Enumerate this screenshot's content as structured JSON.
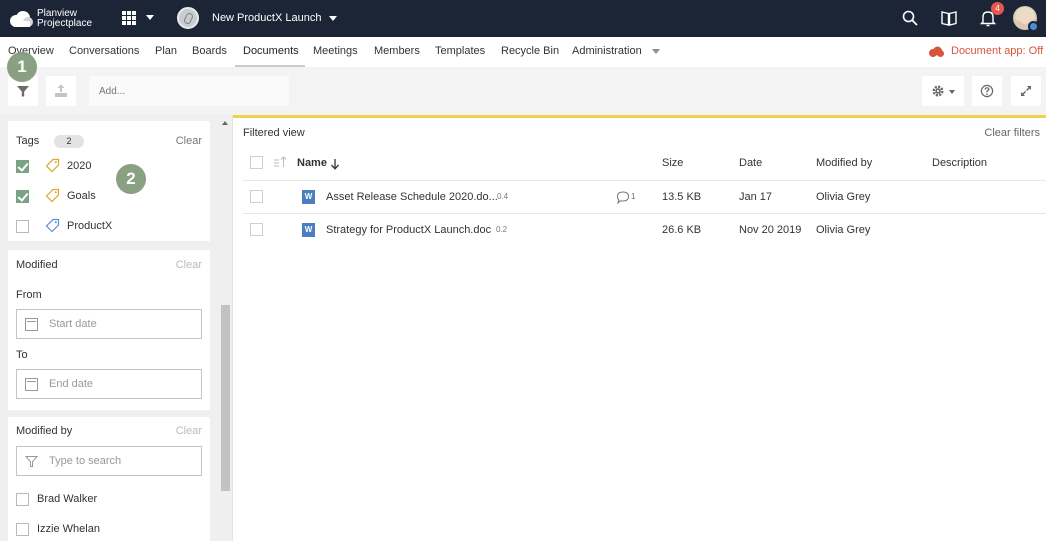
{
  "topbar": {
    "brand_line1": "Planview",
    "brand_line2": "Projectplace",
    "project_name": "New ProductX Launch",
    "notification_count": "4",
    "icons": [
      "cloud-logo-icon",
      "apps-grid-icon",
      "search-icon",
      "book-icon",
      "bell-icon",
      "avatar"
    ]
  },
  "nav": {
    "tabs": [
      "Overview",
      "Conversations",
      "Plan",
      "Boards",
      "Documents",
      "Meetings",
      "Members",
      "Templates",
      "Recycle Bin",
      "Administration"
    ],
    "active_tab": "Documents",
    "doc_app_status": "Document app: Off",
    "accent_color": "#d8553d"
  },
  "toolbar": {
    "add_placeholder": "Add...",
    "icons": [
      "filter-icon",
      "upload-icon",
      "gear-icon",
      "help-icon",
      "expand-icon"
    ]
  },
  "callouts": {
    "step1": "1",
    "step2": "2"
  },
  "filters": {
    "tags": {
      "title": "Tags",
      "count": "2",
      "clear_label": "Clear",
      "items": [
        {
          "label": "2020",
          "checked": true
        },
        {
          "label": "Goals",
          "checked": true
        },
        {
          "label": "ProductX",
          "checked": false
        }
      ]
    },
    "modified": {
      "title": "Modified",
      "clear_label": "Clear",
      "from_label": "From",
      "to_label": "To",
      "start_placeholder": "Start date",
      "end_placeholder": "End date"
    },
    "modified_by": {
      "title": "Modified by",
      "clear_label": "Clear",
      "search_placeholder": "Type to search",
      "people": [
        "Brad Walker",
        "Izzie Whelan"
      ]
    }
  },
  "list": {
    "filtered_label": "Filtered view",
    "clear_filters_label": "Clear filters",
    "columns": {
      "name": "Name",
      "size": "Size",
      "date": "Date",
      "modified_by": "Modified by",
      "description": "Description"
    },
    "rows": [
      {
        "name": "Asset Release Schedule 2020.do...",
        "version": "0.4",
        "comments": "1",
        "size": "13.5 KB",
        "date": "Jan 17",
        "modified_by": "Olivia Grey",
        "description": ""
      },
      {
        "name": "Strategy for ProductX Launch.doc",
        "version": "0.2",
        "comments": "",
        "size": "26.6 KB",
        "date": "Nov 20 2019",
        "modified_by": "Olivia Grey",
        "description": ""
      }
    ],
    "accent_color": "#f3cf4c"
  }
}
